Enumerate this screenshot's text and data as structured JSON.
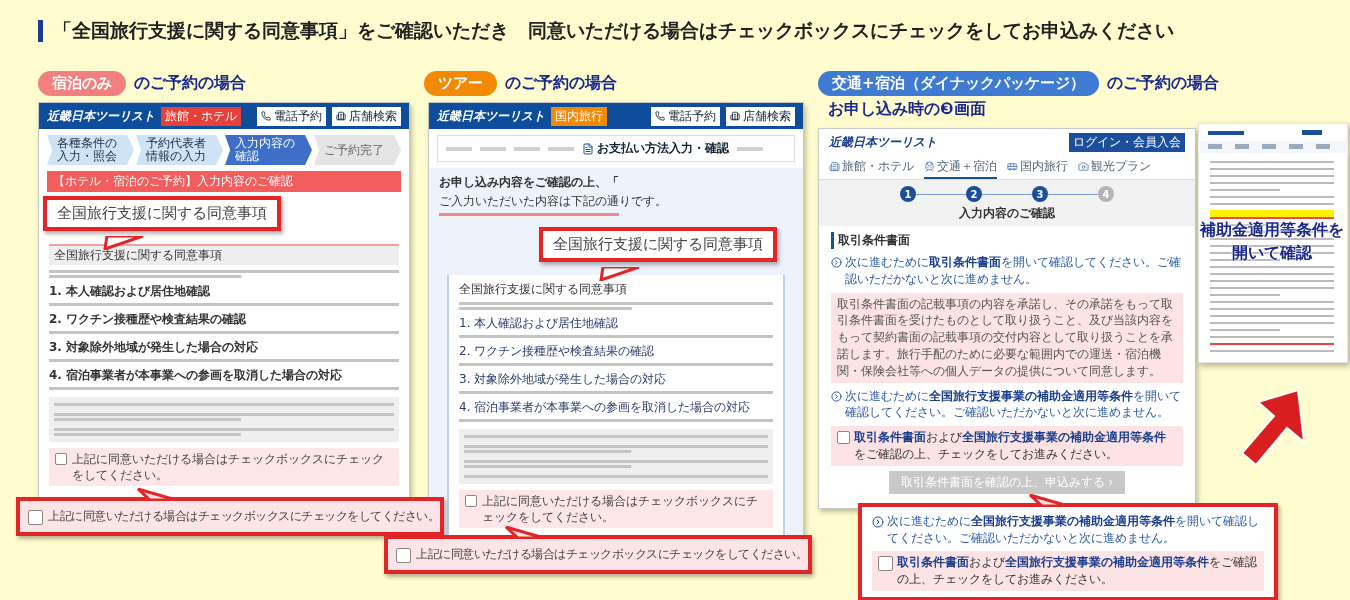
{
  "heading": "「全国旅行支援に関する同意事項」をご確認いただき　同意いただける場合はチェックボックスにチェックをしてお申込みください",
  "panels": [
    {
      "kind": "hotel",
      "tag": {
        "label": "宿泊のみ",
        "color": "#f28080"
      },
      "title": "のご予約の場合",
      "site": {
        "logo": "近畿日本ツーリスト",
        "badge": {
          "label": "旅館・ホテル",
          "color": "#e5403a"
        },
        "buttons": [
          "電話予約",
          "店舗検索"
        ]
      },
      "steps": [
        {
          "label": "各種条件の入力・照会",
          "selected": false
        },
        {
          "label": "予約代表者情報の入力",
          "selected": false
        },
        {
          "label": "入力内容の確認",
          "selected": true
        },
        {
          "label": "ご予約完了",
          "selected": false
        }
      ],
      "banner": "【ホテル・宿泊のご予約】入力内容のご確認",
      "callout": "全国旅行支援に関する同意事項",
      "section_title": "全国旅行支援に関する同意事項",
      "items": [
        "1. 本人確認および居住地確認",
        "2. ワクチン接種歴や検査結果の確認",
        "3. 対象除外地域が発生した場合の対応",
        "4. 宿泊事業者が本事業への参画を取消した場合の対応"
      ],
      "agree": {
        "label": "上記に同意いただける場合はチェックボックスにチェックをしてください。",
        "checked": false
      },
      "agree_callout": {
        "label": "上記に同意いただける場合はチェックボックスにチェックをしてください。",
        "checked": false
      }
    },
    {
      "kind": "tour",
      "tag": {
        "label": "ツアー",
        "color": "#f28a05"
      },
      "title": "のご予約の場合",
      "site": {
        "logo": "近畿日本ツーリスト",
        "badge": {
          "label": "国内旅行",
          "color": "#f28a05"
        },
        "buttons": [
          "電話予約",
          "店舗検索"
        ]
      },
      "current_step": "お支払い方法入力・確認",
      "intro": [
        "お申し込み内容をご確認の上、「",
        "ご入力いただいた内容は下記の通りです。"
      ],
      "callout": "全国旅行支援に関する同意事項",
      "section_title": "全国旅行支援に関する同意事項",
      "items": [
        "1. 本人確認および居住地確認",
        "2. ワクチン接種歴や検査結果の確認",
        "3. 対象除外地域が発生した場合の対応",
        "4. 宿泊事業者が本事業への参画を取消した場合の対応"
      ],
      "agree": {
        "label": "上記に同意いただける場合はチェックボックスにチェックをしてください。",
        "checked": false
      },
      "agree_callout": {
        "label": "上記に同意いただける場合はチェックボックスにチェックをしてください。",
        "checked": false
      }
    },
    {
      "kind": "dynamic",
      "tag": {
        "label": "交通+宿泊（ダイナックパッケージ）",
        "color": "#3f7bd2"
      },
      "title": "のご予約の場合",
      "subtitle": "お申し込み時の❸画面",
      "site": {
        "logo": "近畿日本ツーリスト",
        "login": "ログイン・会員入会",
        "nav": [
          {
            "label": "旅館・ホテル",
            "selected": false
          },
          {
            "label": "交通＋宿泊",
            "selected": true
          },
          {
            "label": "国内旅行",
            "selected": false
          },
          {
            "label": "観光プラン",
            "selected": false
          }
        ]
      },
      "steps": [
        {
          "label": "1",
          "reached": true
        },
        {
          "label": "2",
          "reached": true
        },
        {
          "label": "3",
          "reached": true
        },
        {
          "label": "4",
          "reached": false
        }
      ],
      "step_title": "入力内容のご確認",
      "section_title": "取引条件書面",
      "notice": "次に進むために**取引条件書面**を開いて確認してください。ご確認いただかないと次に進めません。",
      "terms": "取引条件書面の記載事項の内容を承諾し、その承諾をもって取引条件書面を受けたものとして取り扱うこと、及び当該内容をもって契約書面の記載事項の交付内容として取り扱うことを承諾します。旅行手配のために必要な範囲内での運送・宿泊機関・保険会社等への個人データの提供について同意します。",
      "notice_2": "次に進むために**全国旅行支援事業の補助金適用等条件**を開いて確認してください。ご確認いただかないと次に進めません。",
      "agree": {
        "label": "**取引条件書面**および**全国旅行支援事業の補助金適用等条件**をご確認の上、チェックをしてお進みください。",
        "checked": false
      },
      "submit": {
        "label": "取引条件書面を確認の上、申込みする ›",
        "disabled": true
      },
      "document_caption": [
        "補助金適用等条件を",
        "開いて確認"
      ],
      "callout": {
        "notice": "次に進むために**全国旅行支援事業の補助金適用等条件**を開いて確認してください。ご確認いただかないと次に進めません。",
        "agree": {
          "label": "**取引条件書面**および**全国旅行支援事業の補助金適用等条件**をご確認の上、チェックをしてお進みください。",
          "checked": false
        }
      }
    }
  ]
}
